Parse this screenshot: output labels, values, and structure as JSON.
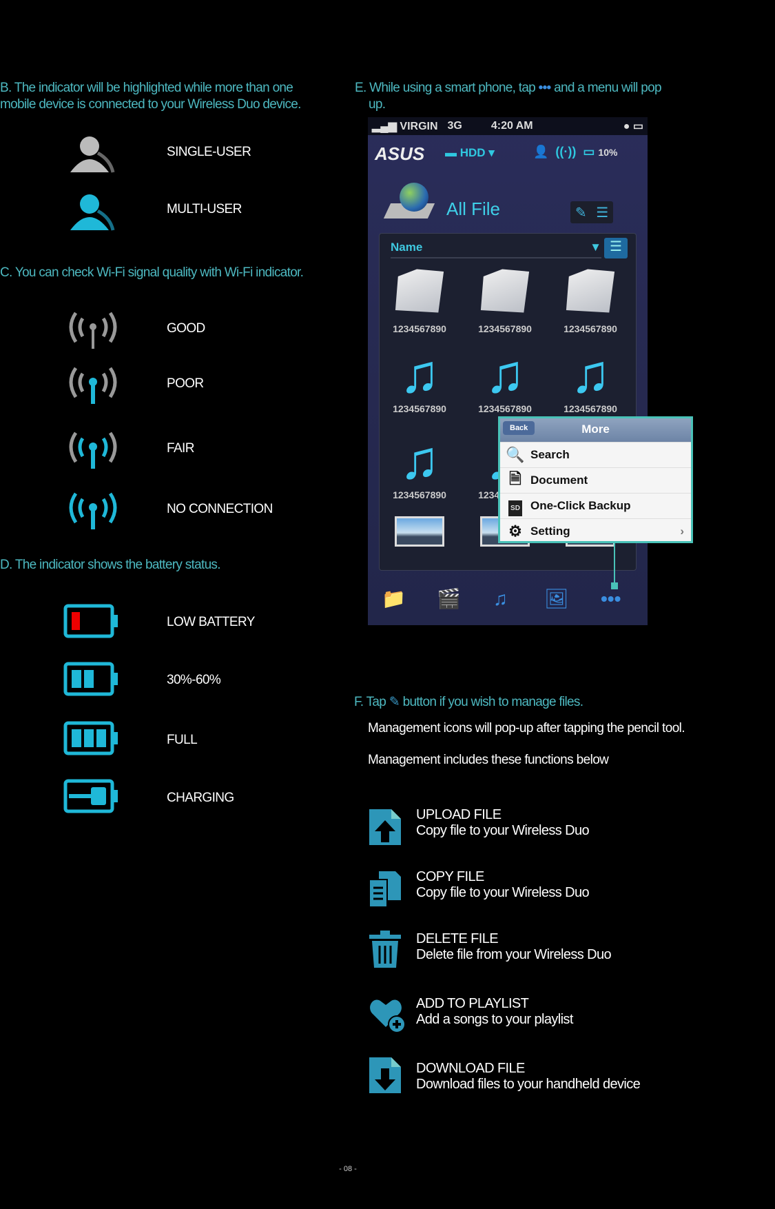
{
  "section_b": {
    "heading": "B. The indicator will be highlighted while more than one mobile device is connected to your Wireless Duo device.",
    "items": [
      {
        "label": "SINGLE-USER",
        "icon": "user-icon-gray"
      },
      {
        "label": "MULTI-USER",
        "icon": "user-icon-blue"
      }
    ]
  },
  "section_c": {
    "heading": "C. You can check Wi-Fi signal quality with Wi-Fi indicator.",
    "items": [
      {
        "label": "GOOD"
      },
      {
        "label": "POOR"
      },
      {
        "label": "FAIR"
      },
      {
        "label": "NO CONNECTION"
      }
    ]
  },
  "section_d": {
    "heading": "D. The indicator shows the battery status.",
    "items": [
      {
        "label": "LOW BATTERY"
      },
      {
        "label": "30%-60%"
      },
      {
        "label": "FULL"
      },
      {
        "label": "CHARGING"
      }
    ]
  },
  "section_e": {
    "heading_pre": "E. While using a smart phone, tap",
    "heading_icon": "•••",
    "heading_post": "and a menu will pop up."
  },
  "phone": {
    "carrier": "VIRGIN",
    "network": "3G",
    "time": "4:20 AM",
    "brand": "ASUS",
    "storage": "HDD",
    "battery": "10%",
    "title": "All File",
    "sort": "Name",
    "file_name": "1234567890",
    "menu": {
      "back": "Back",
      "title": "More",
      "items": [
        "Search",
        "Document",
        "One-Click Backup",
        "Setting"
      ],
      "sd": "SD"
    }
  },
  "section_f": {
    "heading_pre": "F. Tap",
    "heading_post": "button if you wish to manage files.",
    "line1": "Management icons will pop-up after tapping the pencil tool.",
    "line2": "Management includes these functions below",
    "functions": [
      {
        "title": "UPLOAD FILE",
        "desc": "Copy file to your Wireless Duo"
      },
      {
        "title": "COPY FILE",
        "desc": "Copy file to your Wireless Duo"
      },
      {
        "title": "DELETE FILE",
        "desc": "Delete file from your Wireless Duo"
      },
      {
        "title": "ADD TO PLAYLIST",
        "desc": "Add a songs to your playlist"
      },
      {
        "title": "DOWNLOAD FILE",
        "desc": "Download files to your handheld device"
      }
    ]
  },
  "page_number": "- 08 -",
  "colors": {
    "heading": "#4db8c0",
    "icon_blue": "#1fb8d8",
    "menu_border": "#49c2b8"
  }
}
